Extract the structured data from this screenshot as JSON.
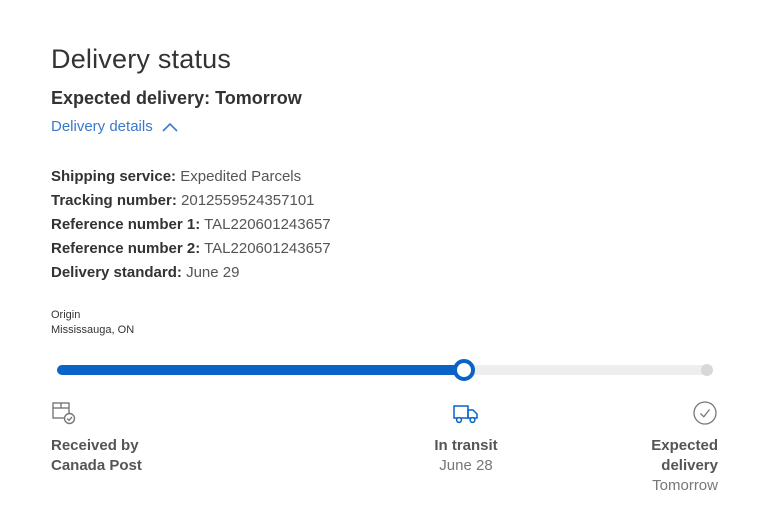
{
  "page_title": "Delivery status",
  "expected_delivery": "Expected delivery: Tomorrow",
  "details_toggle": {
    "label": "Delivery details",
    "state": "expanded"
  },
  "shipment_info": [
    {
      "label": "Shipping service:",
      "value": "Expedited Parcels"
    },
    {
      "label": "Tracking number:",
      "value": "2012559524357101"
    },
    {
      "label": "Reference number 1:",
      "value": "TAL220601243657"
    },
    {
      "label": "Reference number 2:",
      "value": "TAL220601243657"
    },
    {
      "label": "Delivery standard:",
      "value": "June 29"
    }
  ],
  "origin": {
    "label": "Origin",
    "location": "Mississauga, ON"
  },
  "progress": {
    "current_stage_index": 1,
    "fraction_complete": 0.62
  },
  "stages": [
    {
      "name": "Received by Canada Post",
      "sub": "",
      "icon": "package-check-icon"
    },
    {
      "name": "In transit",
      "sub": "June 28",
      "icon": "delivery-truck-icon"
    },
    {
      "name": "Expected delivery",
      "sub": "Tomorrow",
      "icon": "check-circle-icon"
    }
  ],
  "colors": {
    "accent": "#0b62c7",
    "link": "#3a79c9",
    "track": "#eeeeee",
    "text": "#333333"
  }
}
